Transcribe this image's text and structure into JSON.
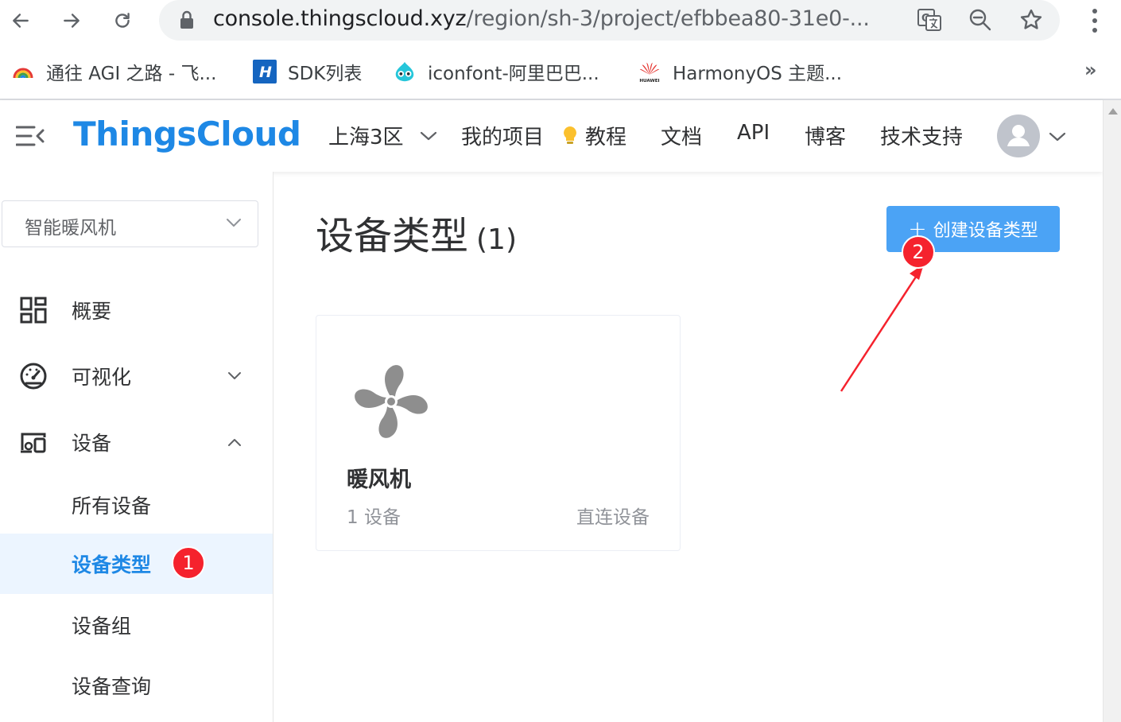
{
  "browser": {
    "url_host": "console.thingscloud.xyz",
    "url_path": "/region/sh-3/project/efbbea80-31e0-...",
    "bookmarks": [
      {
        "label": "通往 AGI 之路 - 飞...",
        "icon": "rainbow-icon"
      },
      {
        "label": "SDK列表",
        "icon": "h-logo-icon"
      },
      {
        "label": "iconfont-阿里巴巴...",
        "icon": "iconfont-mascot-icon"
      },
      {
        "label": "HarmonyOS 主题...",
        "icon": "huawei-logo-icon"
      }
    ],
    "bookmarks_more": "»",
    "huawei_logo_text": "HUAWEI"
  },
  "header": {
    "logo": "ThingsCloud",
    "region": "上海3区",
    "nav": {
      "my_projects": "我的项目",
      "tutorial": "教程",
      "docs": "文档",
      "api": "API",
      "blog": "博客",
      "support": "技术支持"
    }
  },
  "sidebar": {
    "project": "智能暖风机",
    "menu": {
      "overview": "概要",
      "visualization": "可视化",
      "devices": "设备"
    },
    "device_sub": {
      "all_devices": "所有设备",
      "device_types": "设备类型",
      "device_groups": "设备组",
      "device_query": "设备查询"
    }
  },
  "main": {
    "title": "设备类型",
    "count": "(1)",
    "create_button": "创建设备类型",
    "cards": [
      {
        "name": "暖风机",
        "count": "1 设备",
        "type": "直连设备",
        "icon": "fan-icon"
      }
    ]
  },
  "annotations": {
    "badge1": "1",
    "badge2": "2"
  },
  "colors": {
    "brand": "#1e88e5",
    "button": "#4ba3f5",
    "badge": "#f5222d",
    "active_bg": "#ecf5ff"
  }
}
